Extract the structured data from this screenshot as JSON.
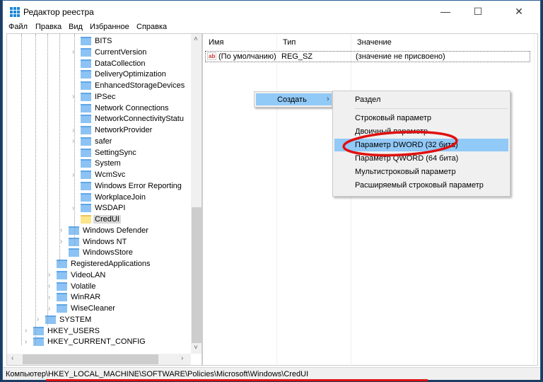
{
  "window": {
    "title": "Редактор реестра",
    "minimize": "—",
    "maximize": "☐",
    "close": "✕"
  },
  "menu": [
    "Файл",
    "Правка",
    "Вид",
    "Избранное",
    "Справка"
  ],
  "tree": [
    {
      "label": "BITS",
      "level": 4,
      "expander": false
    },
    {
      "label": "CurrentVersion",
      "level": 4,
      "expander": true
    },
    {
      "label": "DataCollection",
      "level": 4,
      "expander": false
    },
    {
      "label": "DeliveryOptimization",
      "level": 4,
      "expander": false
    },
    {
      "label": "EnhancedStorageDevices",
      "level": 4,
      "expander": false
    },
    {
      "label": "IPSec",
      "level": 4,
      "expander": true
    },
    {
      "label": "Network Connections",
      "level": 4,
      "expander": false
    },
    {
      "label": "NetworkConnectivityStatu",
      "level": 4,
      "expander": false
    },
    {
      "label": "NetworkProvider",
      "level": 4,
      "expander": true
    },
    {
      "label": "safer",
      "level": 4,
      "expander": true
    },
    {
      "label": "SettingSync",
      "level": 4,
      "expander": false
    },
    {
      "label": "System",
      "level": 4,
      "expander": false
    },
    {
      "label": "WcmSvc",
      "level": 4,
      "expander": true
    },
    {
      "label": "Windows Error Reporting",
      "level": 4,
      "expander": false
    },
    {
      "label": "WorkplaceJoin",
      "level": 4,
      "expander": false
    },
    {
      "label": "WSDAPI",
      "level": 4,
      "expander": true
    },
    {
      "label": "CredUI",
      "level": 4,
      "expander": false,
      "selected": true
    },
    {
      "label": "Windows Defender",
      "level": 3,
      "expander": true
    },
    {
      "label": "Windows NT",
      "level": 3,
      "expander": true
    },
    {
      "label": "WindowsStore",
      "level": 3,
      "expander": false
    },
    {
      "label": "RegisteredApplications",
      "level": 2,
      "expander": false
    },
    {
      "label": "VideoLAN",
      "level": 2,
      "expander": true
    },
    {
      "label": "Volatile",
      "level": 2,
      "expander": true
    },
    {
      "label": "WinRAR",
      "level": 2,
      "expander": true
    },
    {
      "label": "WiseCleaner",
      "level": 2,
      "expander": true
    },
    {
      "label": "SYSTEM",
      "level": 1,
      "expander": true
    },
    {
      "label": "HKEY_USERS",
      "level": 0,
      "expander": true
    },
    {
      "label": "HKEY_CURRENT_CONFIG",
      "level": 0,
      "expander": true
    }
  ],
  "columns": {
    "name": "Имя",
    "type": "Тип",
    "value": "Значение"
  },
  "values": [
    {
      "icon": "ab",
      "name": "(По умолчанию)",
      "type": "REG_SZ",
      "value": "(значение не присвоено)"
    }
  ],
  "context_menu": {
    "create": "Создать",
    "arrow": "›"
  },
  "submenu": [
    "Раздел",
    "Строковый параметр",
    "Двоичный параметр",
    "Параметр DWORD (32 бита)",
    "Параметр QWORD (64 бита)",
    "Мультистроковый параметр",
    "Расширяемый строковый параметр"
  ],
  "submenu_highlighted": 3,
  "status": "Компьютер\\HKEY_LOCAL_MACHINE\\SOFTWARE\\Policies\\Microsoft\\Windows\\CredUI",
  "colors": {
    "highlight": "#91c9f7",
    "annotation": "#e01010",
    "folder": "#8cc3f4"
  }
}
